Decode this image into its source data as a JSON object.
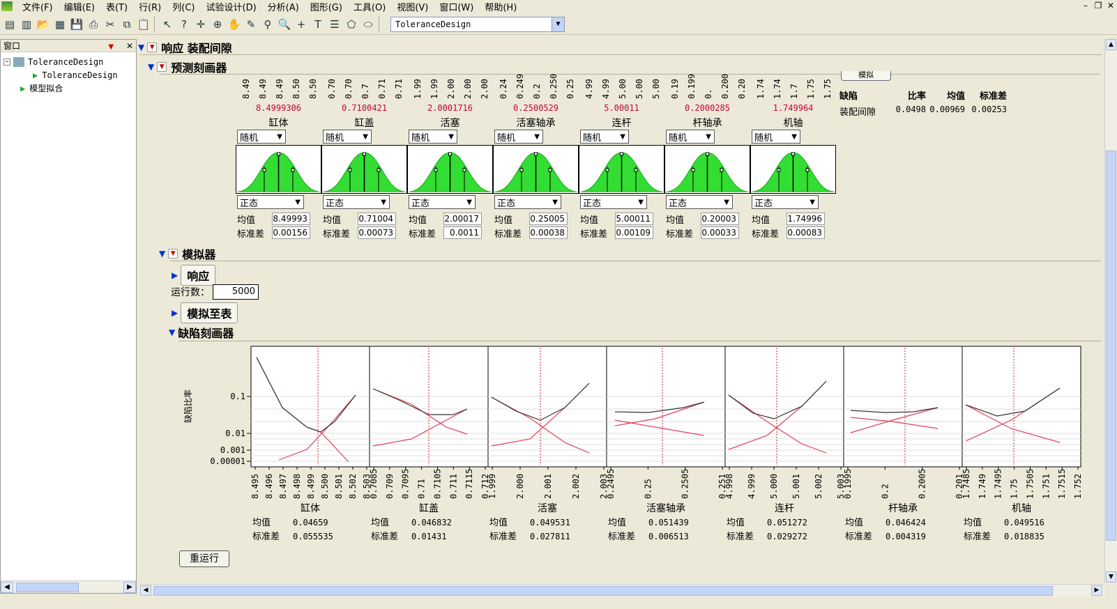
{
  "menu": [
    "文件(F)",
    "编辑(E)",
    "表(T)",
    "行(R)",
    "列(C)",
    "试验设计(D)",
    "分析(A)",
    "图形(G)",
    "工具(O)",
    "视图(V)",
    "窗口(W)",
    "帮助(H)"
  ],
  "toolbar": {
    "combo_value": "ToleranceDesign"
  },
  "window_panel": {
    "title": "窗口",
    "tree": [
      "ToleranceDesign",
      "ToleranceDesign",
      "模型拟合"
    ]
  },
  "report": {
    "response_title": "响应 装配间隙",
    "profiler_title": "预测刻画器",
    "simulate_button": "模拟",
    "simulator_title": "模拟器",
    "response_sub": "响应",
    "runs_label": "运行数：",
    "runs_value": "5000",
    "simulate_to_table": "模拟至表",
    "defect_profiler": "缺陷刻画器",
    "rerun": "重运行",
    "mean_label": "均值",
    "sd_label": "标准差",
    "random_label": "随机",
    "normal_label": "正态"
  },
  "defect_table": {
    "headers": [
      "缺陷",
      "比率",
      "均值",
      "标准差"
    ],
    "row": [
      "装配间隙",
      "0.0498",
      "0.00969",
      "0.00253"
    ]
  },
  "factors": [
    {
      "name": "缸体",
      "current": "8.4999306",
      "mean": "8.49993",
      "sd": "0.00156",
      "ticks": [
        "8.49",
        "8.49",
        "8.49",
        "8.50",
        "8.50"
      ],
      "def_ticks": [
        "8.495",
        "8.496",
        "8.497",
        "8.498",
        "8.499",
        "8.500",
        "8.501",
        "8.502",
        "8.503"
      ],
      "def_mean": "0.04659",
      "def_sd": "0.055535"
    },
    {
      "name": "缸盖",
      "current": "0.7100421",
      "mean": "0.71004",
      "sd": "0.00073",
      "ticks": [
        "0.70",
        "0.70",
        "0.7",
        "0.71",
        "0.71"
      ],
      "def_ticks": [
        "0.7085",
        "0.709",
        "0.7095",
        "0.71",
        "0.7105",
        "0.711",
        "0.7115",
        "0.712"
      ],
      "def_mean": "0.046832",
      "def_sd": "0.01431"
    },
    {
      "name": "活塞",
      "current": "2.0001716",
      "mean": "2.00017",
      "sd": "0.0011",
      "ticks": [
        "1.99",
        "1.99",
        "2.00",
        "2.00",
        "2.00"
      ],
      "def_ticks": [
        "1.999",
        "2.000",
        "2.001",
        "2.002",
        "2.003"
      ],
      "def_mean": "0.049531",
      "def_sd": "0.027811"
    },
    {
      "name": "活塞轴承",
      "current": "0.2500529",
      "mean": "0.25005",
      "sd": "0.00038",
      "ticks": [
        "0.24",
        "0.249",
        "0.2",
        "0.250",
        "0.25"
      ],
      "def_ticks": [
        "0.2495",
        "0.25",
        "0.2505",
        "0.251"
      ],
      "def_mean": "0.051439",
      "def_sd": "0.006513"
    },
    {
      "name": "连杆",
      "current": "5.00011",
      "mean": "5.00011",
      "sd": "0.00109",
      "ticks": [
        "4.99",
        "4.99",
        "5.00",
        "5.00",
        "5.00"
      ],
      "def_ticks": [
        "4.998",
        "4.999",
        "5.000",
        "5.001",
        "5.002",
        "5.003"
      ],
      "def_mean": "0.051272",
      "def_sd": "0.029272"
    },
    {
      "name": "杆轴承",
      "current": "0.2000285",
      "mean": "0.20003",
      "sd": "0.00033",
      "ticks": [
        "0.19",
        "0.199",
        "0.",
        "0.200",
        "0.20"
      ],
      "def_ticks": [
        "0.1995",
        "0.2",
        "0.2005",
        "0.201"
      ],
      "def_mean": "0.046424",
      "def_sd": "0.004319"
    },
    {
      "name": "机轴",
      "current": "1.749964",
      "mean": "1.74996",
      "sd": "0.00083",
      "ticks": [
        "1.74",
        "1.74",
        "1.7",
        "1.75",
        "1.75"
      ],
      "def_ticks": [
        "1.7485",
        "1.749",
        "1.7495",
        "1.75",
        "1.7505",
        "1.751",
        "1.7515",
        "1.752"
      ],
      "def_mean": "0.049516",
      "def_sd": "0.018835"
    }
  ],
  "defect_chart": {
    "ylabel": "缺陷比率",
    "yticks": [
      "0.1",
      "0.01",
      "0.001",
      "0.00001"
    ]
  }
}
